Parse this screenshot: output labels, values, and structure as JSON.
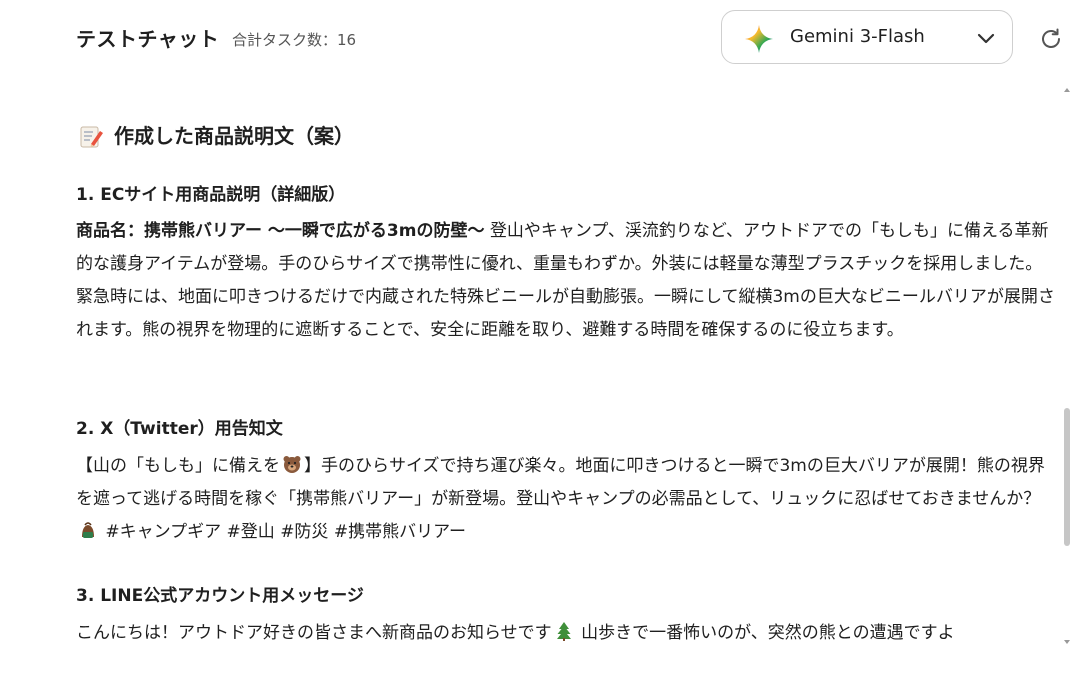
{
  "header": {
    "title": "テストチャット",
    "task_count": "合計タスク数：16",
    "model_select": {
      "value": "Gemini 3-Flash"
    }
  },
  "section": {
    "title": "作成した商品説明文（案）"
  },
  "items": [
    {
      "heading": "1. ECサイト用商品説明（詳細版）",
      "bold": "商品名：携帯熊バリアー 〜一瞬で広がる3mの防壁〜",
      "body": " 登山やキャンプ、渓流釣りなど、アウトドアでの「もしも」に備える革新的な護身アイテムが登場。手のひらサイズで携帯性に優れ、重量もわずか。外装には軽量な薄型プラスチックを採用しました。緊急時には、地面に叩きつけるだけで内蔵された特殊ビニールが自動膨張。一瞬にして縦横3mの巨大なビニールバリアが展開されます。熊の視界を物理的に遮断することで、安全に距離を取り、避難する時間を確保するのに役立ちます。"
    },
    {
      "heading": "2. X（Twitter）用告知文",
      "body_a": "【山の「もしも」に備えを",
      "body_b": "】手のひらサイズで持ち運び楽々。地面に叩きつけると一瞬で3mの巨大バリアが展開！熊の視界を遮って逃げる時間を稼ぐ「携帯熊バリアー」が新登場。登山やキャンプの必需品として、リュックに忍ばせておきませんか？",
      "body_c": " #キャンプギア #登山 #防災 #携帯熊バリアー"
    },
    {
      "heading": "3. LINE公式アカウント用メッセージ",
      "body_a": "こんにちは！アウトドア好きの皆さまへ新商品のお知らせです",
      "body_b": " 山歩きで一番怖いのが、突然の熊との遭遇ですよ"
    }
  ],
  "icons": {
    "memo": "memo-icon",
    "bear": "bear-face-icon",
    "backpack": "backpack-icon",
    "tree": "evergreen-tree-icon",
    "refresh": "refresh-icon",
    "chevron": "chevron-down-icon",
    "gemini": "gemini-sparkle-icon"
  },
  "colors": {
    "text": "#1f1f1f",
    "muted": "#555555",
    "border": "#cfcfcf",
    "scrollbar": "#c6c6c6"
  }
}
